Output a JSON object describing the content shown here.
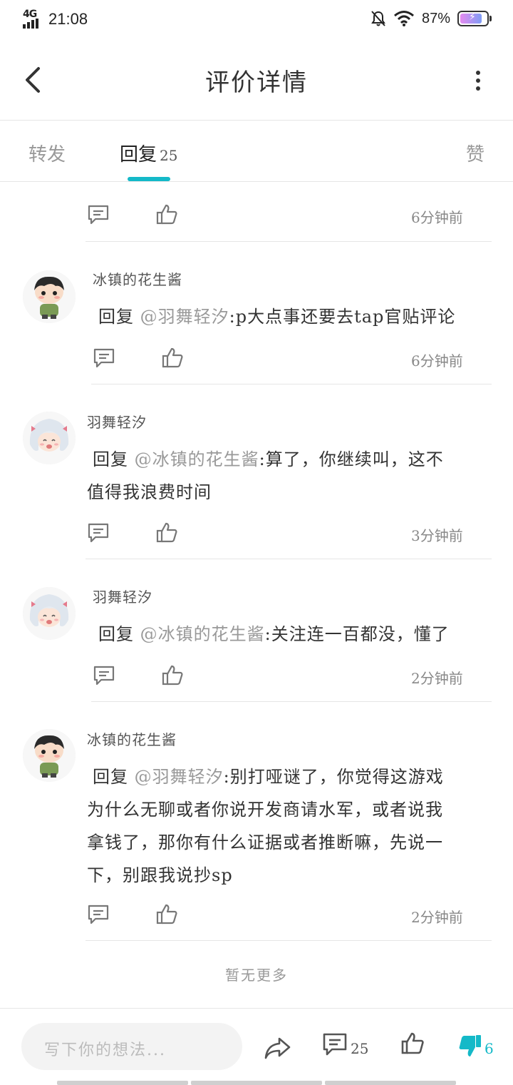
{
  "status_bar": {
    "network": "4G",
    "time": "21:08",
    "battery": "87%",
    "battery_level": 0.87,
    "icons": [
      "signal-icon",
      "mute-icon",
      "wifi-icon",
      "battery-icon"
    ]
  },
  "header": {
    "title": "评价详情",
    "back_icon": "back-arrow-icon",
    "more_icon": "more-vertical-icon"
  },
  "tabs": [
    {
      "label": "转发"
    },
    {
      "label": "回复",
      "count": "25",
      "active": true
    },
    {
      "label": "赞"
    }
  ],
  "first_row": {
    "time": "6分钟前"
  },
  "comments": [
    {
      "username": "冰镇的花生酱",
      "prefix": "回复",
      "mention": "@羽舞轻汐",
      "text_lines": [
        ":p大点事还要去tap官贴评论"
      ],
      "time": "6分钟前"
    },
    {
      "username": "羽舞轻汐",
      "prefix": "回复",
      "mention": "@冰镇的花生酱",
      "text_lines": [
        ":算了，你继续叫，这不",
        "值得我浪费时间"
      ],
      "time": "3分钟前"
    },
    {
      "username": "羽舞轻汐",
      "prefix": "回复",
      "mention": "@冰镇的花生酱",
      "text_lines": [
        ":关注连一百都没，懂了"
      ],
      "time": "2分钟前"
    },
    {
      "username": "冰镇的花生酱",
      "prefix": "回复",
      "mention": "@羽舞轻汐",
      "text_lines": [
        ":别打哑谜了，你觉得这游戏",
        "为什么无聊或者你说开发商请水军，或者说我",
        "拿钱了，那你有什么证据或者推断嘛，先说一",
        "下，别跟我说抄sp"
      ],
      "time": "2分钟前"
    }
  ],
  "footer_note": "暂无更多",
  "bottom_bar": {
    "input_placeholder": "写下你的想法...",
    "comment_count": "25",
    "dislike_count": "6",
    "accent_color": "#14b9c8"
  }
}
